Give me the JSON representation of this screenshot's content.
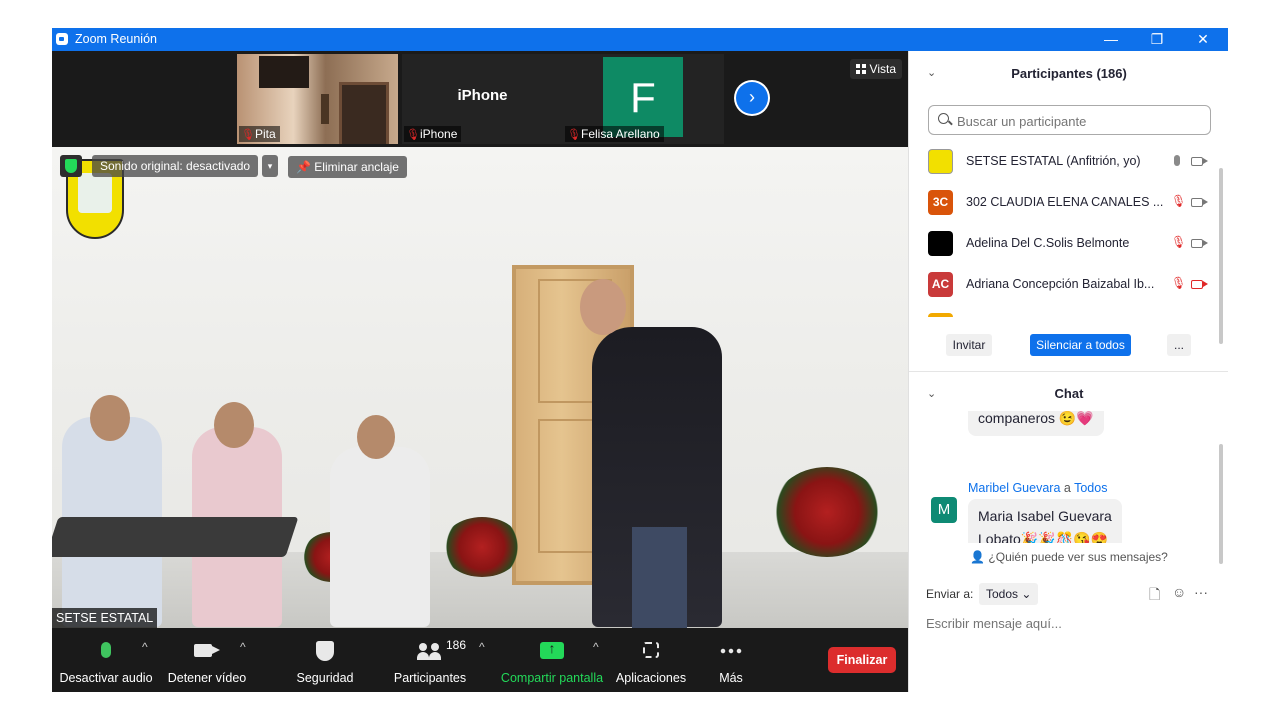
{
  "window": {
    "title": "Zoom Reunión",
    "minimize": "—",
    "restore": "❐",
    "close": "✕"
  },
  "strip": {
    "thumbs": [
      {
        "name": "Pita"
      },
      {
        "name": "iPhone",
        "display_name": "iPhone"
      },
      {
        "name": "Felisa Arellano",
        "initial": "F"
      }
    ],
    "next": "›",
    "view_label": "Vista"
  },
  "video": {
    "audio_label": "Sonido original: desactivado",
    "audio_caret": "▾",
    "unpin_label": "Eliminar anclaje",
    "speaker_name": "SETSE ESTATAL"
  },
  "toolbar": {
    "audio": "Desactivar audio",
    "video": "Detener vídeo",
    "security": "Seguridad",
    "participants": "Participantes",
    "participants_count": "186",
    "share": "Compartir pantalla",
    "apps": "Aplicaciones",
    "more": "Más",
    "end": "Finalizar",
    "caret": "^"
  },
  "participants_panel": {
    "title": "Participantes (186)",
    "caret": "⌄",
    "search_placeholder": "Buscar un participante",
    "rows": [
      {
        "avatar": "",
        "name": "SETSE ESTATAL (Anfitrión, yo)",
        "avatar_color": "#f2e000"
      },
      {
        "avatar": "3C",
        "name": "302 CLAUDIA ELENA CANALES ...",
        "avatar_color": "#d9540a"
      },
      {
        "avatar": "",
        "name": "Adelina Del C.Solis Belmonte",
        "avatar_color": "#000000"
      },
      {
        "avatar": "AC",
        "name": "Adriana Concepción Baizabal Ib...",
        "avatar_color": "#c93a3a"
      }
    ],
    "invite": "Invitar",
    "mute_all": "Silenciar a todos",
    "more": "..."
  },
  "chat": {
    "title": "Chat",
    "caret": "⌄",
    "prev_message": "companeros 😉💗",
    "sender": "Maribel Guevara",
    "to_word": "a",
    "recipient": "Todos",
    "sender_initial": "M",
    "message_line1": "Maria Isabel Guevara",
    "message_line2": "Lobato🎉🎉🎊😘😍",
    "who_can_see": "¿Quién puede ver sus mensajes?",
    "send_to_label": "Enviar a:",
    "send_to_value": "Todos ⌄",
    "input_placeholder": "Escribir mensaje aquí...",
    "more": "···"
  }
}
